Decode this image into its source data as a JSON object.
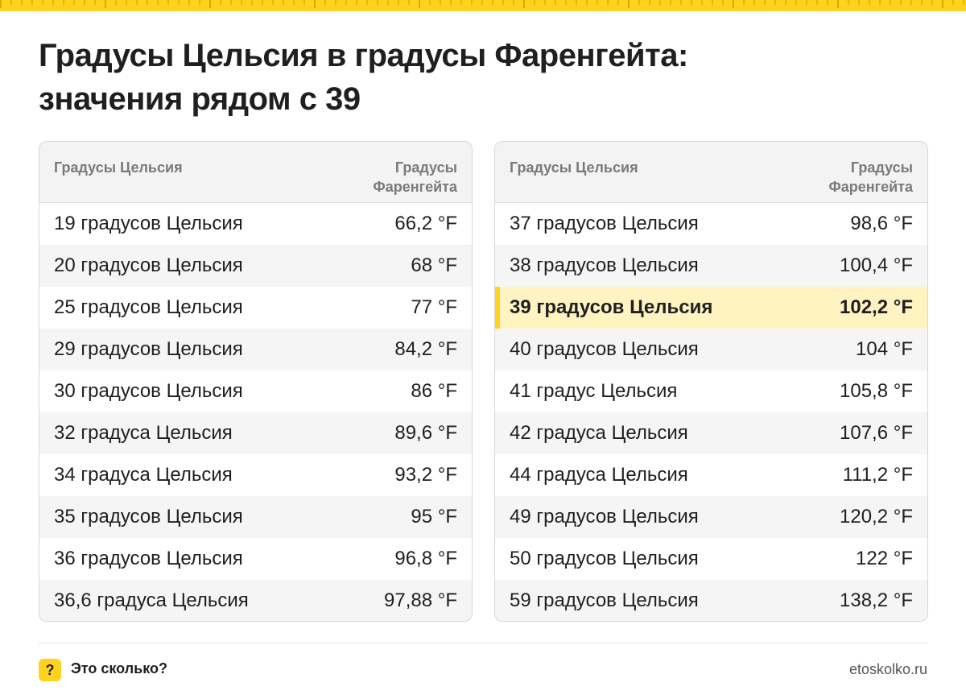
{
  "title_line1": "Градусы Цельсия в градусы Фаренгейта:",
  "title_line2": "значения рядом с 39",
  "headers": {
    "celsius": "Градусы Цельсия",
    "fahrenheit_line1": "Градусы",
    "fahrenheit_line2": "Фаренгейта"
  },
  "left_rows": [
    {
      "c": "19 градусов Цельсия",
      "f": "66,2 °F"
    },
    {
      "c": "20 градусов Цельсия",
      "f": "68 °F"
    },
    {
      "c": "25 градусов Цельсия",
      "f": "77 °F"
    },
    {
      "c": "29 градусов Цельсия",
      "f": "84,2 °F"
    },
    {
      "c": "30 градусов Цельсия",
      "f": "86 °F"
    },
    {
      "c": "32 градуса Цельсия",
      "f": "89,6 °F"
    },
    {
      "c": "34 градуса Цельсия",
      "f": "93,2 °F"
    },
    {
      "c": "35 градусов Цельсия",
      "f": "95 °F"
    },
    {
      "c": "36 градусов Цельсия",
      "f": "96,8 °F"
    },
    {
      "c": "36,6 градуса Цельсия",
      "f": "97,88 °F"
    }
  ],
  "right_rows": [
    {
      "c": "37 градусов Цельсия",
      "f": "98,6 °F"
    },
    {
      "c": "38 градусов Цельсия",
      "f": "100,4 °F"
    },
    {
      "c": "39 градусов Цельсия",
      "f": "102,2 °F",
      "highlight": true
    },
    {
      "c": "40 градусов Цельсия",
      "f": "104 °F"
    },
    {
      "c": "41 градус Цельсия",
      "f": "105,8 °F"
    },
    {
      "c": "42 градуса Цельсия",
      "f": "107,6 °F"
    },
    {
      "c": "44 градуса Цельсия",
      "f": "111,2 °F"
    },
    {
      "c": "49 градусов Цельсия",
      "f": "120,2 °F"
    },
    {
      "c": "50 градусов Цельсия",
      "f": "122 °F"
    },
    {
      "c": "59 градусов Цельсия",
      "f": "138,2 °F"
    }
  ],
  "footer": {
    "logo_glyph": "?",
    "brand": "Это сколько?",
    "site": "etoskolko.ru"
  },
  "colors": {
    "accent": "#ffd21f",
    "highlight": "#fff3c2",
    "header_bg": "#f3f3f3",
    "stripe_bg": "#f5f5f5"
  }
}
